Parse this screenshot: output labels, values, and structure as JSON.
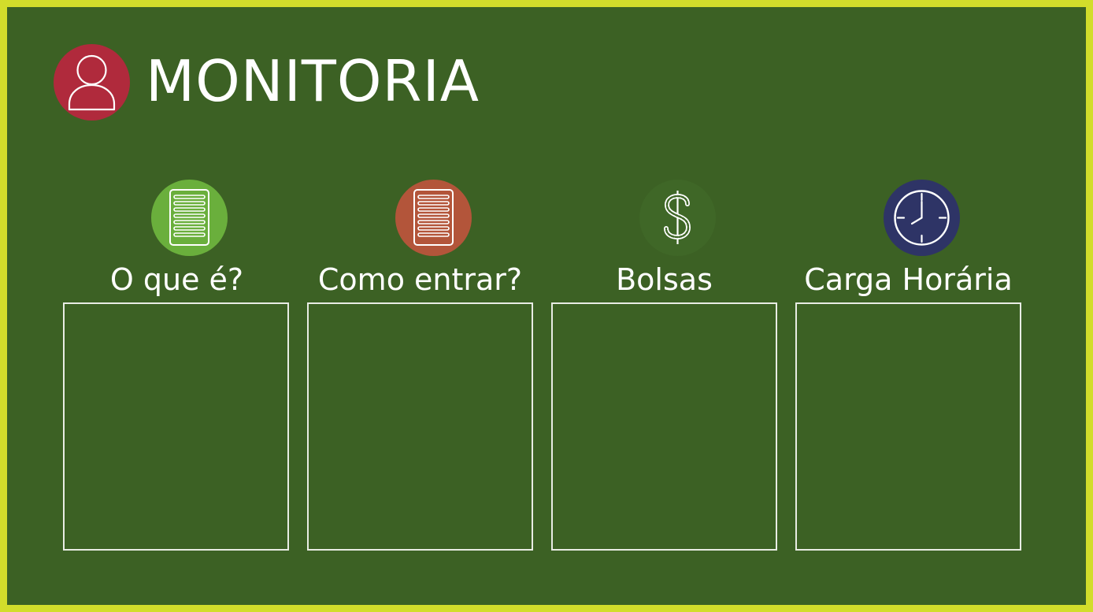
{
  "title": "MONITORIA",
  "title_icon": "user-icon",
  "colors": {
    "border": "#d2dd2b",
    "background": "#3c6124",
    "title_icon": "#b02a3c"
  },
  "columns": [
    {
      "label": "O que é?",
      "icon": "document-icon",
      "icon_color": "#6aaf3c"
    },
    {
      "label": "Como entrar?",
      "icon": "document-icon",
      "icon_color": "#b3553a"
    },
    {
      "label": "Bolsas",
      "icon": "dollar-icon",
      "icon_color": "#3f6727"
    },
    {
      "label": "Carga Horária",
      "icon": "clock-icon",
      "icon_color": "#2e3466"
    }
  ]
}
